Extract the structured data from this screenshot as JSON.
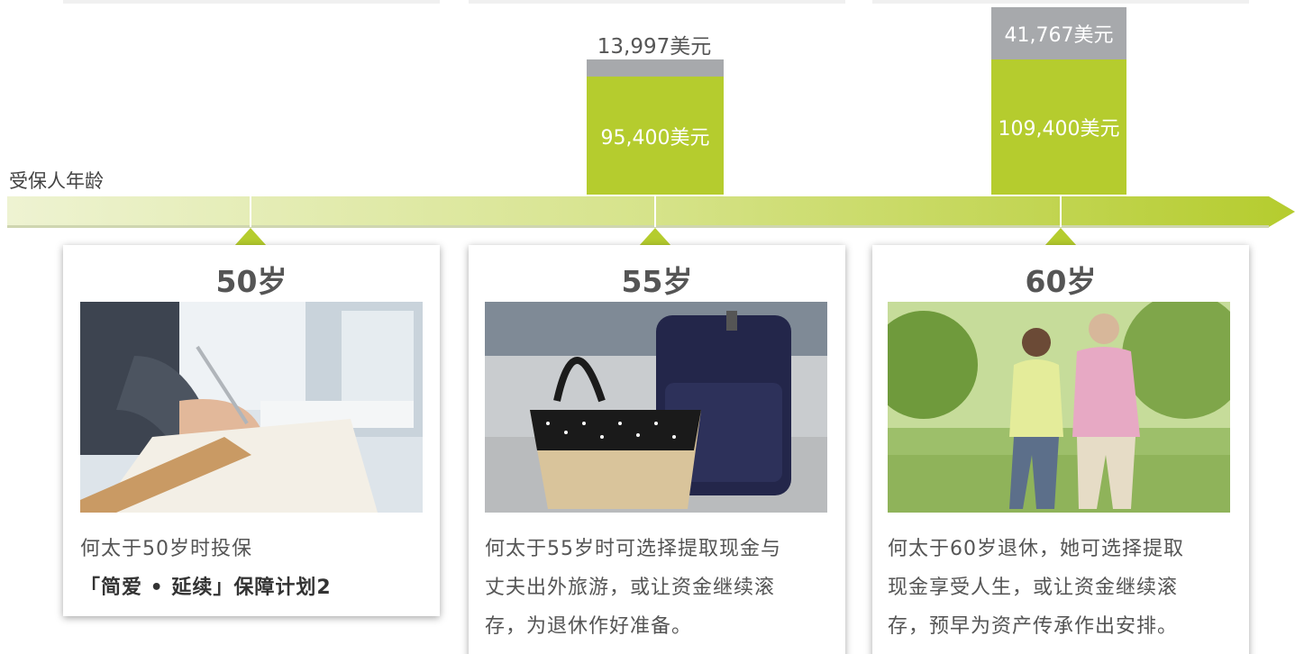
{
  "axis_title": "受保人年龄",
  "stages": [
    {
      "age": "50岁",
      "text_line1": "何太于50岁时投保",
      "text_line2": "「简爱 • 延续」保障计划2",
      "photo": "woman-writing-photo"
    },
    {
      "age": "55岁",
      "withdraw_label": "13,997美元",
      "value_label": "95,400美元",
      "text_lines": [
        "何太于55岁时可选择提取现金与",
        "丈夫出外旅游，或让资金继续滚",
        "存，为退休作好准备。"
      ],
      "photo": "travel-bags-photo"
    },
    {
      "age": "60岁",
      "withdraw_label": "41,767美元",
      "value_label": "109,400美元",
      "text_lines": [
        "何太于60岁退休，她可选择提取",
        "现金享受人生，或让资金继续滚",
        "存，预早为资产传承作出安排。"
      ],
      "photo": "couple-walking-photo"
    }
  ],
  "colors": {
    "green": "#b5cc2e",
    "grey": "#a7a9ac",
    "text": "#555555"
  }
}
